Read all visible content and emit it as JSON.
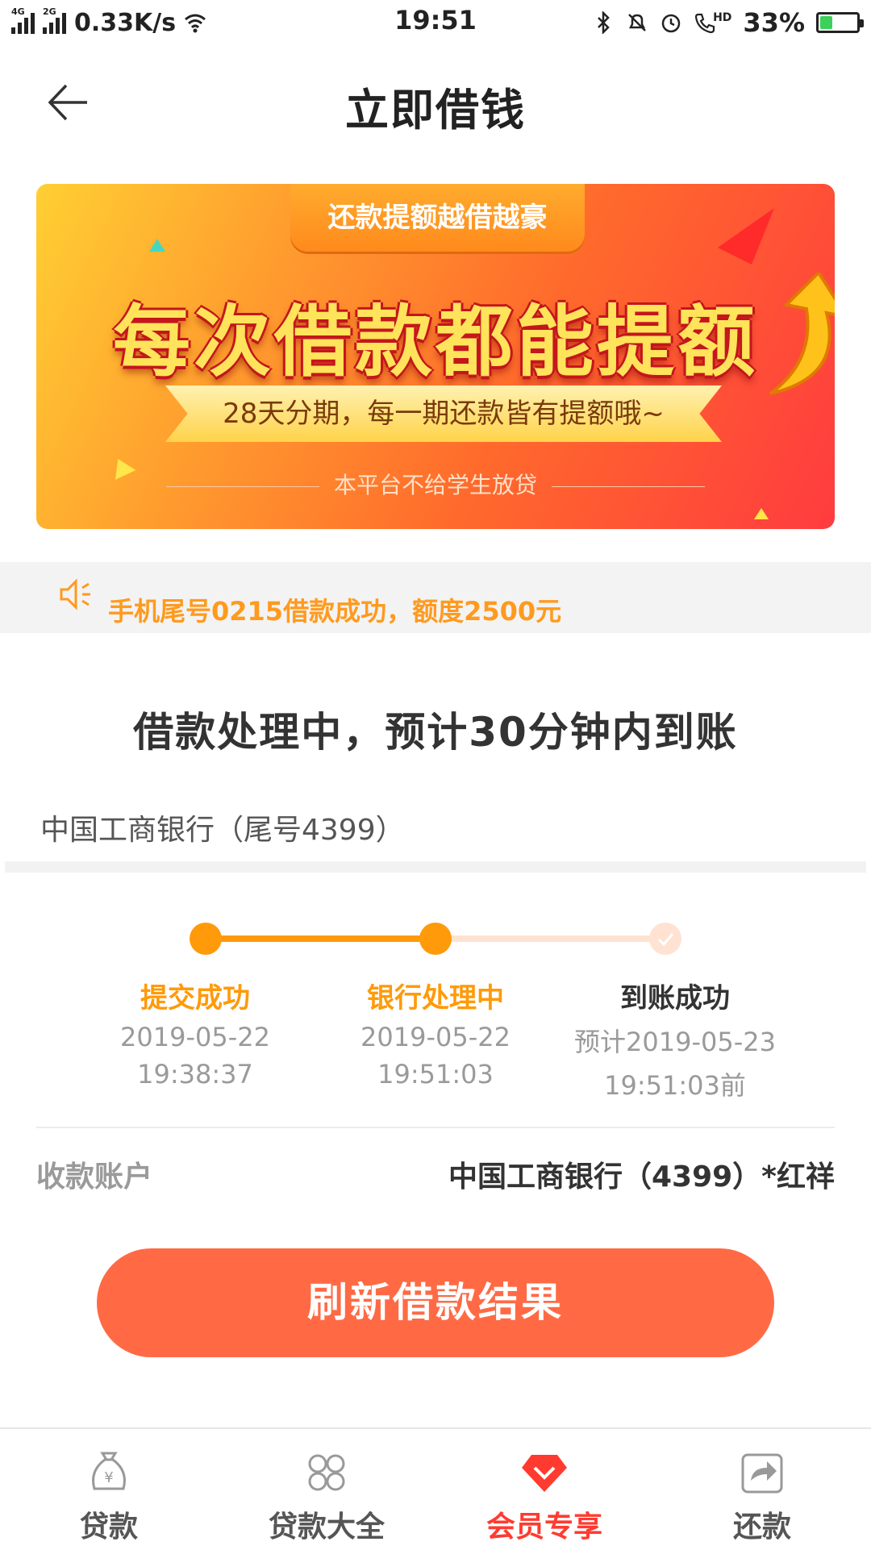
{
  "status_bar": {
    "signal1_tag": "4G",
    "signal2_tag": "2G",
    "speed": "0.33K/s",
    "time": "19:51",
    "hd_tag": "HD",
    "battery_percent": "33%",
    "battery_level": 0.33,
    "icons": [
      "wifi-icon",
      "bluetooth-icon",
      "bell-muted-icon",
      "alarm-icon",
      "hd-call-icon",
      "battery-charging-icon"
    ]
  },
  "header": {
    "title": "立即借钱",
    "back_icon": "back-arrow-icon"
  },
  "banner": {
    "tab": "还款提额越借越豪",
    "headline": "每次借款都能提额",
    "ribbon": "28天分期，每一期还款皆有提额哦~",
    "note": "本平台不给学生放贷"
  },
  "notice": {
    "icon": "speaker-icon",
    "text": "手机尾号0215借款成功，额度2500元"
  },
  "status": {
    "title": "借款处理中，预计30分钟内到账",
    "bank": "中国工商银行（尾号4399）"
  },
  "progress": {
    "steps": [
      {
        "label": "提交成功",
        "date": "2019-05-22",
        "time": "19:38:37",
        "state": "done"
      },
      {
        "label": "银行处理中",
        "date": "2019-05-22",
        "time": "19:51:03",
        "state": "current"
      },
      {
        "label": "到账成功",
        "date": "预计2019-05-23",
        "time": "19:51:03前",
        "state": "pending"
      }
    ],
    "colors": {
      "active": "#ff9a0a",
      "inactive": "#ffe2d2",
      "pending_label": "#333333"
    }
  },
  "account": {
    "label": "收款账户",
    "value": "中国工商银行（4399）*红祥"
  },
  "refresh_button": "刷新借款结果",
  "tabbar": {
    "active_color": "#ff3b30",
    "items": [
      {
        "label": "贷款",
        "icon": "money-bag-icon",
        "active": false
      },
      {
        "label": "贷款大全",
        "icon": "grid-icon",
        "active": false
      },
      {
        "label": "会员专享",
        "icon": "diamond-icon",
        "active": true
      },
      {
        "label": "还款",
        "icon": "share-arrow-icon",
        "active": false
      }
    ]
  }
}
